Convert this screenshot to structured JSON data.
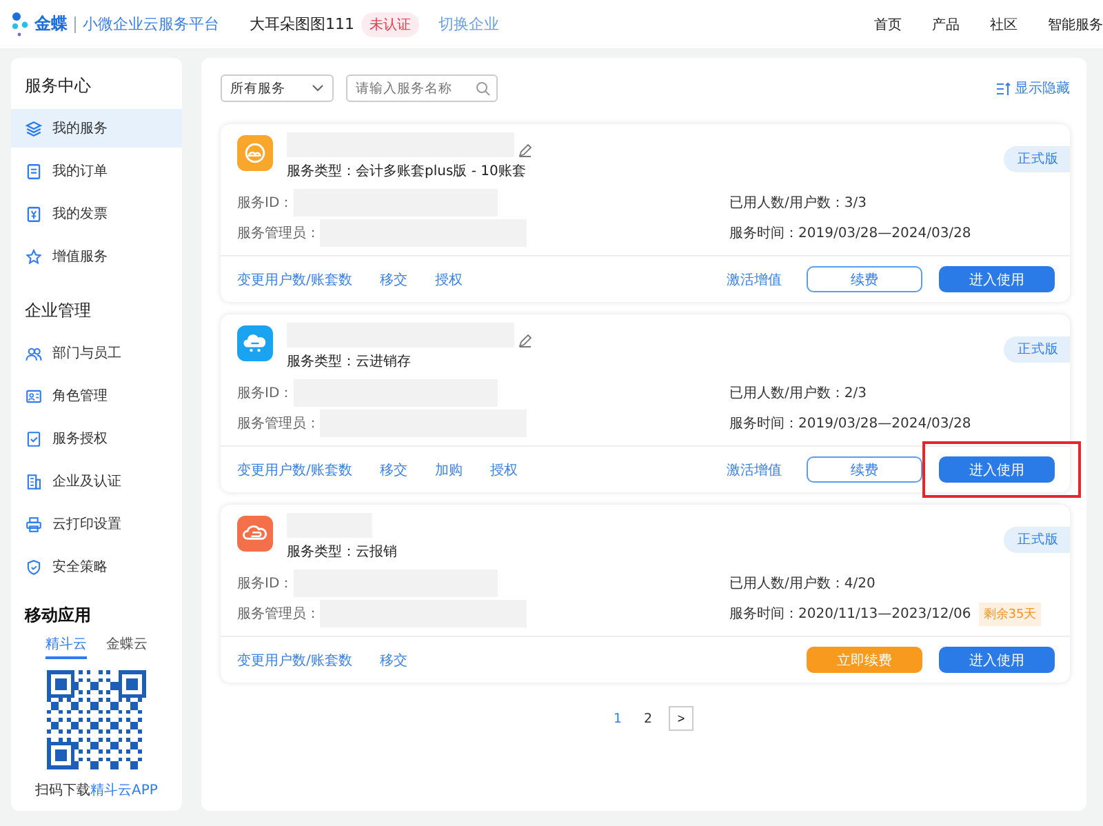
{
  "header": {
    "brand": "金蝶",
    "platform": "小微企业云服务平台",
    "company": "大耳朵图图111",
    "company_status": "未认证",
    "switch_link": "切换企业",
    "nav": [
      "首页",
      "产品",
      "社区",
      "智能服务"
    ]
  },
  "sidebar": {
    "sections": [
      {
        "title": "服务中心",
        "items": [
          {
            "label": "我的服务",
            "selected": true
          },
          {
            "label": "我的订单",
            "selected": false
          },
          {
            "label": "我的发票",
            "selected": false
          },
          {
            "label": "增值服务",
            "selected": false
          }
        ]
      },
      {
        "title": "企业管理",
        "items": [
          {
            "label": "部门与员工",
            "selected": false
          },
          {
            "label": "角色管理",
            "selected": false
          },
          {
            "label": "服务授权",
            "selected": false
          },
          {
            "label": "企业及认证",
            "selected": false
          },
          {
            "label": "云打印设置",
            "selected": false
          },
          {
            "label": "安全策略",
            "selected": false
          }
        ]
      }
    ],
    "mobile": {
      "title": "移动应用",
      "tabs": [
        {
          "label": "精斗云",
          "selected": true
        },
        {
          "label": "金蝶云",
          "selected": false
        }
      ],
      "caption": "扫码下载",
      "caption_link": "精斗云APP"
    }
  },
  "toolbar": {
    "filter": "所有服务",
    "search_placeholder": "请输入服务名称",
    "toggle_hidden": "显示隐藏"
  },
  "services": [
    {
      "color": "#f9a72b",
      "editable": true,
      "type": "服务类型：会计多账套plus版 - 10账套",
      "badge": "正式版",
      "id_label": "服务ID：",
      "admin_label": "服务管理员：",
      "users": "已用人数/用户数：3/3",
      "period": "服务时间：2019/03/28—2024/03/28",
      "links": [
        "变更用户数/账套数",
        "移交",
        "授权"
      ],
      "activate": "激活增值",
      "renew": {
        "label": "续费",
        "kind": "outline"
      },
      "enter": {
        "label": "进入使用",
        "highlighted": false
      }
    },
    {
      "color": "#1aa3f0",
      "editable": true,
      "type": "服务类型：云进销存",
      "badge": "正式版",
      "id_label": "服务ID：",
      "admin_label": "服务管理员：",
      "users": "已用人数/用户数：2/3",
      "period": "服务时间：2019/03/28—2024/03/28",
      "links": [
        "变更用户数/账套数",
        "移交",
        "加购",
        "授权"
      ],
      "activate": "激活增值",
      "renew": {
        "label": "续费",
        "kind": "outline"
      },
      "enter": {
        "label": "进入使用",
        "highlighted": true
      }
    },
    {
      "color": "#f4704a",
      "editable": false,
      "type": "服务类型：云报销",
      "badge": "正式版",
      "id_label": "服务ID：",
      "admin_label": "服务管理员：",
      "users": "已用人数/用户数：4/20",
      "period": "服务时间：2020/11/13—2023/12/06",
      "remaining": "剩余35天",
      "links": [
        "变更用户数/账套数",
        "移交"
      ],
      "renew": {
        "label": "立即续费",
        "kind": "filled"
      },
      "enter": {
        "label": "进入使用",
        "highlighted": false
      }
    }
  ],
  "pagination": {
    "pages": [
      {
        "label": "1",
        "selected": true
      },
      {
        "label": "2",
        "selected": false
      }
    ],
    "next": ">"
  }
}
